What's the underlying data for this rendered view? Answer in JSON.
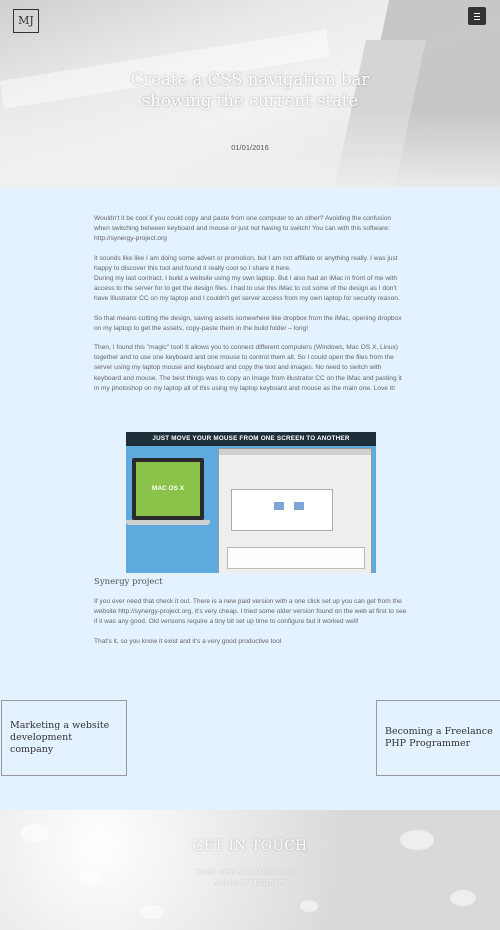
{
  "header": {
    "logo": "MJ",
    "title": "Create a CSS navigation bar showing the current state",
    "date": "01/01/2016"
  },
  "article": {
    "paragraphs": [
      "Wouldn't it be cool if you could copy and paste from one computer to an other? Avoiding the confusion when switching between keyboard and mouse or just not having to switch! You can with this software: http://synergy-project.org",
      "It sounds like like I am doing some advert or promotion, but I am not affiliate or anything really. I was just happy to discover this tool and found it really cool so I share it here.",
      "During my last contract, I build a website using my own laptop. But I also had an iMac in front of me with access to the server for to get the design files. I had to use this iMac to cut some of the design as I don't have Illustrator CC on my laptop and I couldn't get server access from my own laptop for security reason.",
      "So that means cutting the design, saving assets somewhere like dropbox from the iMac, opening dropbox on my laptop to get the assets, copy-paste them in the build folder – long!",
      "Then, I found this \"magic\" tool! It allows you to connect different computers (Windows, Mac OS X, Linux) together and to use one keyboard and one mouse to control them all. So I could open the files from the server using my laptop mouse and keyboard and copy the text and images. No need to switch with keyboard and mouse. The best things was to copy an image from illustrator CC on the iMac and pasting it in my photoshop on my laptop all of this using my laptop keyboard and mouse as the main one. Love it!"
    ],
    "figure": {
      "banner": "JUST MOVE YOUR MOUSE FROM ONE SCREEN TO ANOTHER",
      "laptop_label": "MAC OS X"
    },
    "caption": "Synergy project",
    "paragraphs2": [
      "If you ever need that check it out. There is a new paid version with a one click set up you can get from the website http://synergy-project.org, it's very cheap. I tried some older version found on the web at first to see if it was any good. Old versions require a tiny bit set up time to configure but it worked well!",
      "That's it, so you know it exist and it's a very good productive tool"
    ]
  },
  "nav": {
    "prev": "Marketing a website development company",
    "next": "Becoming a Freelance PHP Programmer"
  },
  "footer": {
    "title": "GET IN TOUCH",
    "email": "Email: mjerred.work@gmail.com",
    "mobile": "Mobile: 07742615973"
  }
}
